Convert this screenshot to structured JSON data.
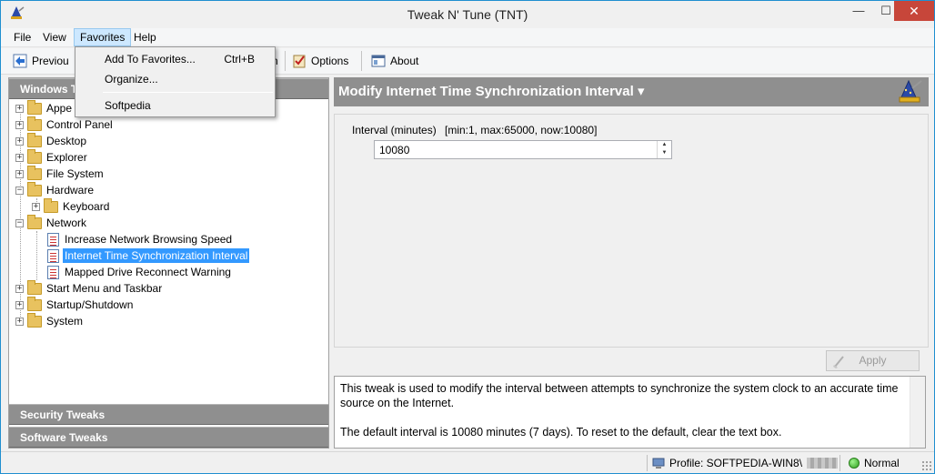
{
  "window": {
    "title": "Tweak N' Tune  (TNT)",
    "min_glyph": "—",
    "max_glyph": "☐",
    "close_glyph": "✕"
  },
  "menu": {
    "file": "File",
    "view": "View",
    "favorites": "Favorites",
    "help": "Help"
  },
  "favorites_menu": {
    "add": "Add To Favorites...",
    "add_shortcut": "Ctrl+B",
    "organize": "Organize...",
    "softpedia": "Softpedia"
  },
  "toolbar": {
    "previous": "Previou",
    "next_partial": "h",
    "options": "Options",
    "about": "About"
  },
  "left_panel": {
    "windows_header": "Windows T",
    "security_header": "Security Tweaks",
    "software_header": "Software Tweaks",
    "tree": [
      {
        "label": "Appe",
        "type": "folder",
        "expander": "+"
      },
      {
        "label": "Control Panel",
        "type": "folder",
        "expander": "+"
      },
      {
        "label": "Desktop",
        "type": "folder",
        "expander": "+"
      },
      {
        "label": "Explorer",
        "type": "folder",
        "expander": "+"
      },
      {
        "label": "File System",
        "type": "folder",
        "expander": "+"
      },
      {
        "label": "Hardware",
        "type": "folder",
        "expander": "−"
      },
      {
        "label": "Keyboard",
        "type": "folder",
        "expander": "+"
      },
      {
        "label": "Network",
        "type": "folder",
        "expander": "−"
      },
      {
        "label": "Increase Network Browsing Speed",
        "type": "tweak"
      },
      {
        "label": "Internet Time Synchronization Interval",
        "type": "tweak",
        "selected": true
      },
      {
        "label": "Mapped Drive Reconnect Warning",
        "type": "tweak"
      },
      {
        "label": "Start Menu and Taskbar",
        "type": "folder",
        "expander": "+"
      },
      {
        "label": "Startup/Shutdown",
        "type": "folder",
        "expander": "+"
      },
      {
        "label": "System",
        "type": "folder",
        "expander": "+"
      }
    ]
  },
  "right_panel": {
    "header": "Modify Internet Time Synchronization Interval",
    "header_arrow": "▾",
    "field_label": "Interval (minutes)",
    "field_range": "[min:1, max:65000, now:10080]",
    "field_value": "10080",
    "spin_up": "▲",
    "spin_down": "▼",
    "apply": "Apply",
    "description_1": "This tweak is used to modify the interval between attempts to synchronize the system clock to an accurate time source on the Internet.",
    "description_2": "The default interval is 10080 minutes (7 days). To reset to the default, clear the text box."
  },
  "statusbar": {
    "profile": "Profile: SOFTPEDIA-WIN8\\",
    "mode": "Normal"
  },
  "colors": {
    "header_gray": "#8f8f8f",
    "selection_blue": "#3399ff",
    "close_red": "#c7463a"
  }
}
